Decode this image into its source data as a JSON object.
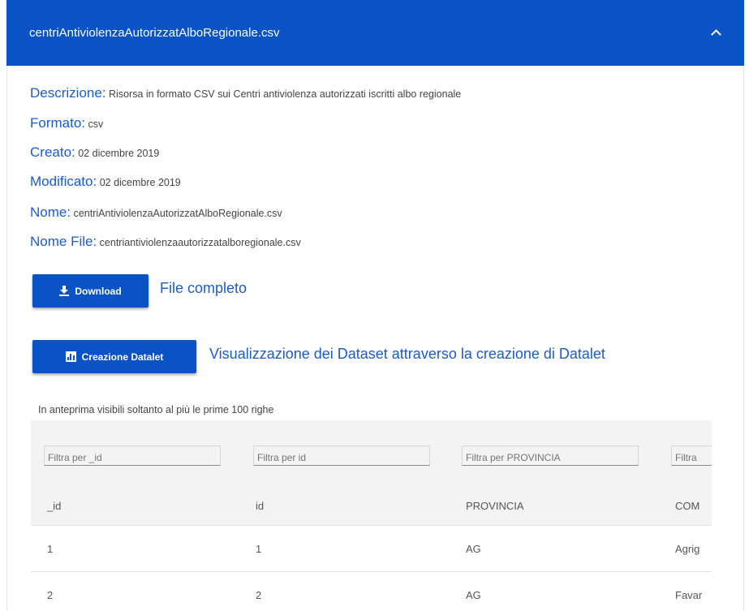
{
  "header": {
    "title": "centriAntiviolenzaAutorizzatAlboRegionale.csv"
  },
  "meta": [
    {
      "key": "Descrizione:",
      "value": "Risorsa in formato CSV sui Centri antiviolenza autorizzati iscritti albo regionale"
    },
    {
      "key": "Formato:",
      "value": "csv"
    },
    {
      "key": "Creato:",
      "value": "02 dicembre 2019"
    },
    {
      "key": "Modificato:",
      "value": "02 dicembre 2019"
    },
    {
      "key": "Nome:",
      "value": "centriAntiviolenzaAutorizzatAlboRegionale.csv"
    },
    {
      "key": "Nome File:",
      "value": "centriantiviolenzaautorizzatalboregionale.csv"
    }
  ],
  "download": {
    "button": "Download",
    "label": "File completo"
  },
  "datalet": {
    "button": "Creazione Datalet",
    "label": "Visualizzazione dei Dataset attraverso la creazione di Datalet"
  },
  "preview_note": "In anteprima visibili soltanto al più le prime 100 righe",
  "table": {
    "filters": [
      "Filtra per _id",
      "Filtra per id",
      "Filtra per PROVINCIA",
      "Filtra"
    ],
    "headers": [
      "_id",
      "id",
      "PROVINCIA",
      "COM"
    ],
    "rows": [
      [
        "1",
        "1",
        "AG",
        "Agrig"
      ],
      [
        "2",
        "2",
        "AG",
        "Favar"
      ]
    ]
  },
  "colors": {
    "primary": "#0a53c6",
    "link": "#1a5bd1"
  }
}
